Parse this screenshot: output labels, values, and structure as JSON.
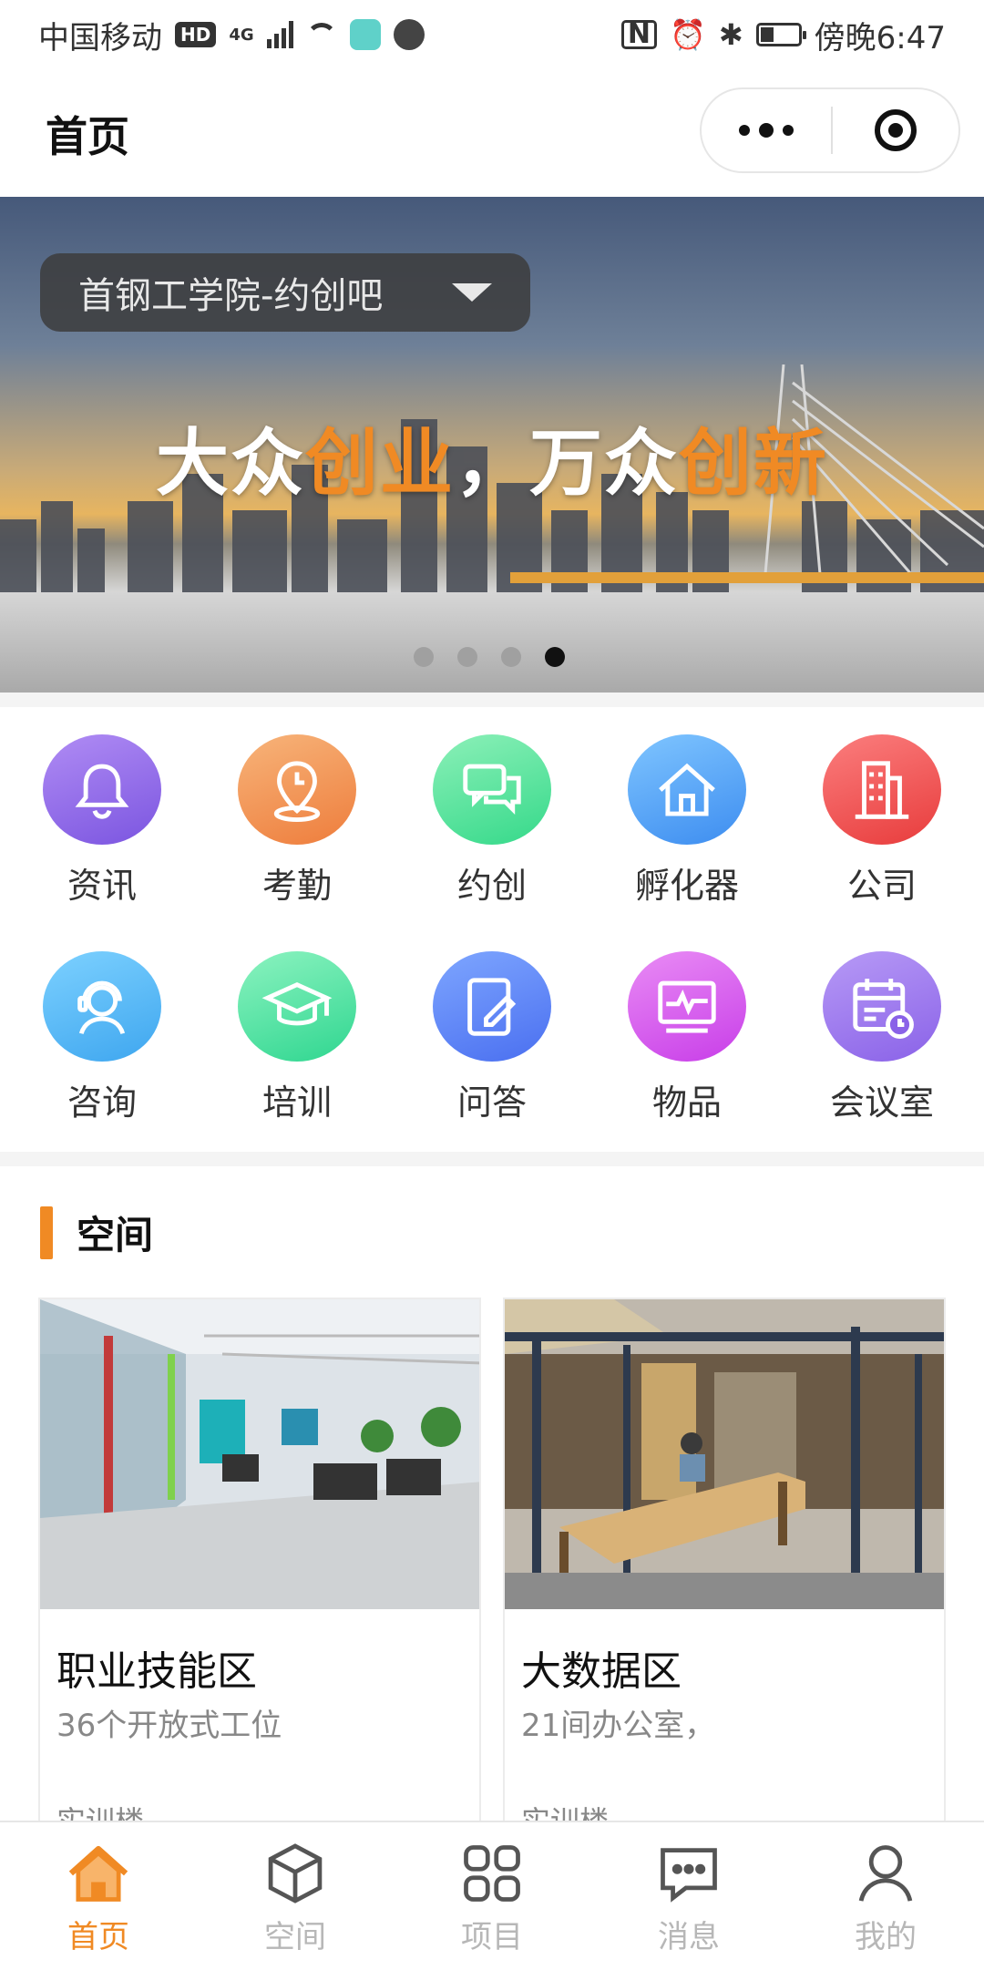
{
  "status_bar": {
    "carrier": "中国移动",
    "hd": "HD",
    "network": "4G",
    "time": "傍晚6:47"
  },
  "nav": {
    "title": "首页"
  },
  "banner": {
    "selector_label": "首钢工学院-约创吧",
    "slogan_1": "大众",
    "slogan_2": "创业",
    "slogan_3": "，万众",
    "slogan_4": "创新",
    "slide_count": 4,
    "active_slide": 4
  },
  "quick_menu": [
    {
      "label": "资讯",
      "icon": "bell-icon",
      "color_from": "#b08cf4",
      "color_to": "#7b55e0"
    },
    {
      "label": "考勤",
      "icon": "location-clock-icon",
      "color_from": "#f7b47a",
      "color_to": "#ee7d3c"
    },
    {
      "label": "约创",
      "icon": "chat-bubbles-icon",
      "color_from": "#8cf0b8",
      "color_to": "#35d98a"
    },
    {
      "label": "孵化器",
      "icon": "house-icon",
      "color_from": "#7fc5ff",
      "color_to": "#3d8df0"
    },
    {
      "label": "公司",
      "icon": "building-icon",
      "color_from": "#fb7e7e",
      "color_to": "#e83c3c"
    },
    {
      "label": "咨询",
      "icon": "headset-person-icon",
      "color_from": "#7dd1ff",
      "color_to": "#3ea6ef"
    },
    {
      "label": "培训",
      "icon": "graduation-cap-icon",
      "color_from": "#8cf3c0",
      "color_to": "#2fd690"
    },
    {
      "label": "问答",
      "icon": "edit-note-icon",
      "color_from": "#7ea6ff",
      "color_to": "#4a6ff0"
    },
    {
      "label": "物品",
      "icon": "monitor-pulse-icon",
      "color_from": "#e98cf5",
      "color_to": "#c83ee8"
    },
    {
      "label": "会议室",
      "icon": "calendar-clock-icon",
      "color_from": "#b79af6",
      "color_to": "#8a62e8"
    }
  ],
  "space_section": {
    "title": "空间",
    "cards": [
      {
        "name": "职业技能区",
        "desc": "36个开放式工位",
        "location": "实训楼"
      },
      {
        "name": "大数据区",
        "desc": "21间办公室，",
        "location": "实训楼"
      }
    ]
  },
  "tabbar": {
    "items": [
      {
        "label": "首页",
        "icon": "home-icon",
        "active": true
      },
      {
        "label": "空间",
        "icon": "cube-icon",
        "active": false
      },
      {
        "label": "项目",
        "icon": "grid-icon",
        "active": false
      },
      {
        "label": "消息",
        "icon": "message-icon",
        "active": false
      },
      {
        "label": "我的",
        "icon": "user-icon",
        "active": false
      }
    ]
  },
  "colors": {
    "accent": "#f08a24",
    "inactive_tab": "#b7b7b7"
  }
}
